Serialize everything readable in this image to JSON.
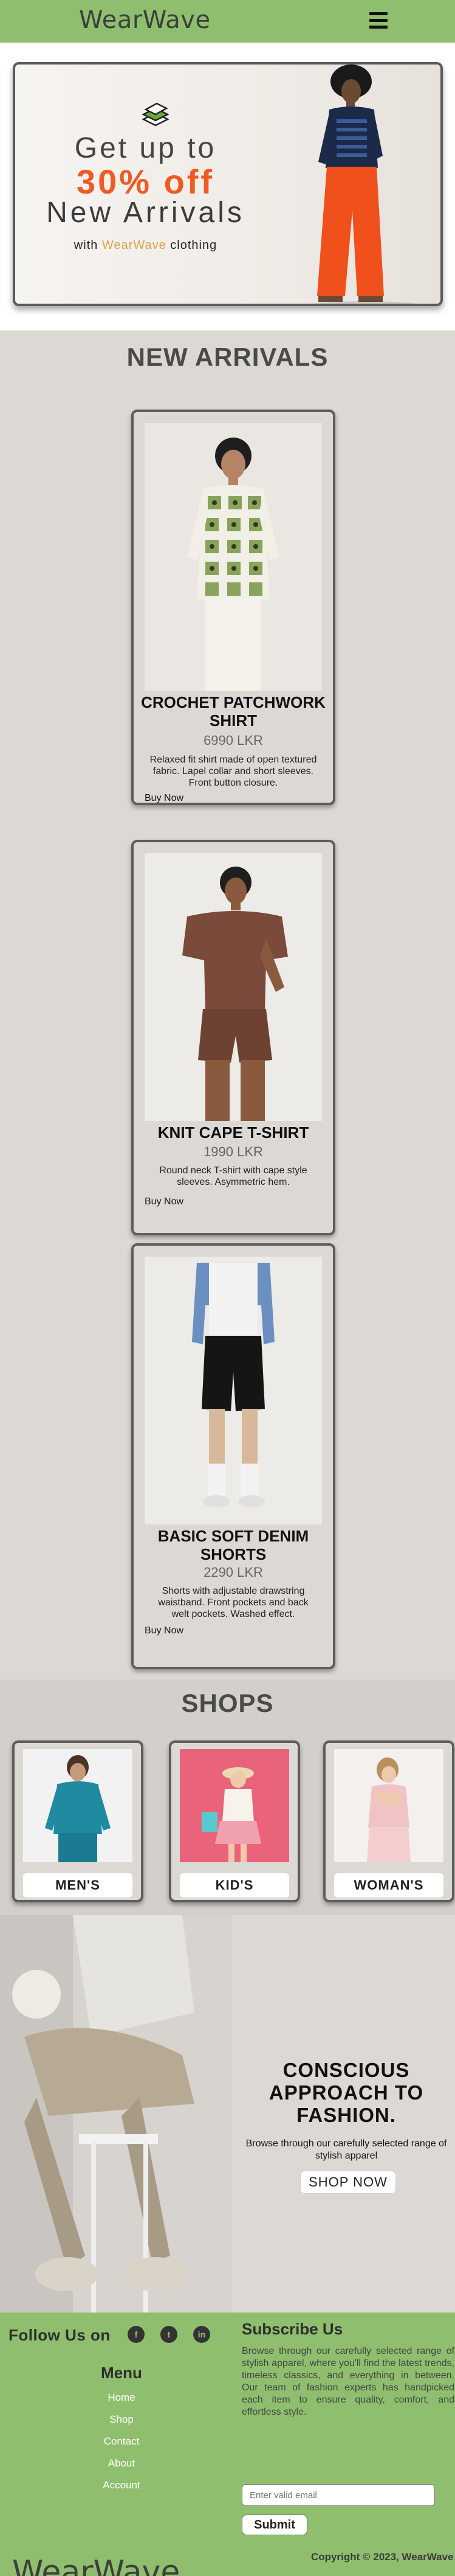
{
  "header": {
    "brand": "WearWave",
    "menu_icon": "hamburger-menu-icon"
  },
  "hero": {
    "icon": "stacked-clothes-icon",
    "line1": "Get up to",
    "line2": "30% off",
    "line3": "New Arrivals",
    "tagline_prefix": "with",
    "tagline_brand": "WearWave",
    "tagline_suffix": "clothing"
  },
  "arrivals": {
    "title": "NEW ARRIVALS",
    "products": [
      {
        "name": "CROCHET PATCHWORK SHIRT",
        "price": "6990 LKR",
        "description": "Relaxed fit shirt made of open textured fabric. Lapel collar and short sleeves. Front button closure.",
        "button": "Buy Now"
      },
      {
        "name": "KNIT CAPE T-SHIRT",
        "price": "1990 LKR",
        "description": "Round neck T-shirt with cape style sleeves. Asymmetric hem.",
        "button": "Buy Now"
      },
      {
        "name": "BASIC SOFT DENIM SHORTS",
        "price": "2290 LKR",
        "description": "Shorts with adjustable drawstring waistband. Front pockets and back welt pockets. Washed effect.",
        "button": "Buy Now"
      }
    ]
  },
  "shops": {
    "title": "SHOPS",
    "items": [
      {
        "label": "MEN'S"
      },
      {
        "label": "KID'S"
      },
      {
        "label": "WOMAN'S"
      }
    ]
  },
  "conscious": {
    "title": "CONSCIOUS APPROACH TO FASHION.",
    "subtitle": "Browse through our carefully selected range of stylish apparel",
    "button": "SHOP NOW"
  },
  "footer": {
    "follow": "Follow Us on",
    "social": [
      "facebook-icon",
      "twitter-icon",
      "linkedin-icon"
    ],
    "menu_title": "Menu",
    "menu": [
      "Home",
      "Shop",
      "Contact",
      "About",
      "Account"
    ],
    "subscribe_title": "Subscribe Us",
    "subscribe_text": "Browse through our carefully selected range of stylish apparel, where you'll find the latest trends, timeless classics, and everything in between. Our team of fashion experts has handpicked each item to ensure quality, comfort, and effortless style.",
    "email_placeholder": "Enter valid email",
    "submit": "Submit",
    "copyright": "Copyright © 2023, WearWave",
    "brand": "WearWave"
  },
  "colors": {
    "header_green": "#8fbf6e",
    "accent_orange": "#ef5a24",
    "brand_gold": "#d8a44b",
    "page_gray": "#dcd9d5"
  }
}
